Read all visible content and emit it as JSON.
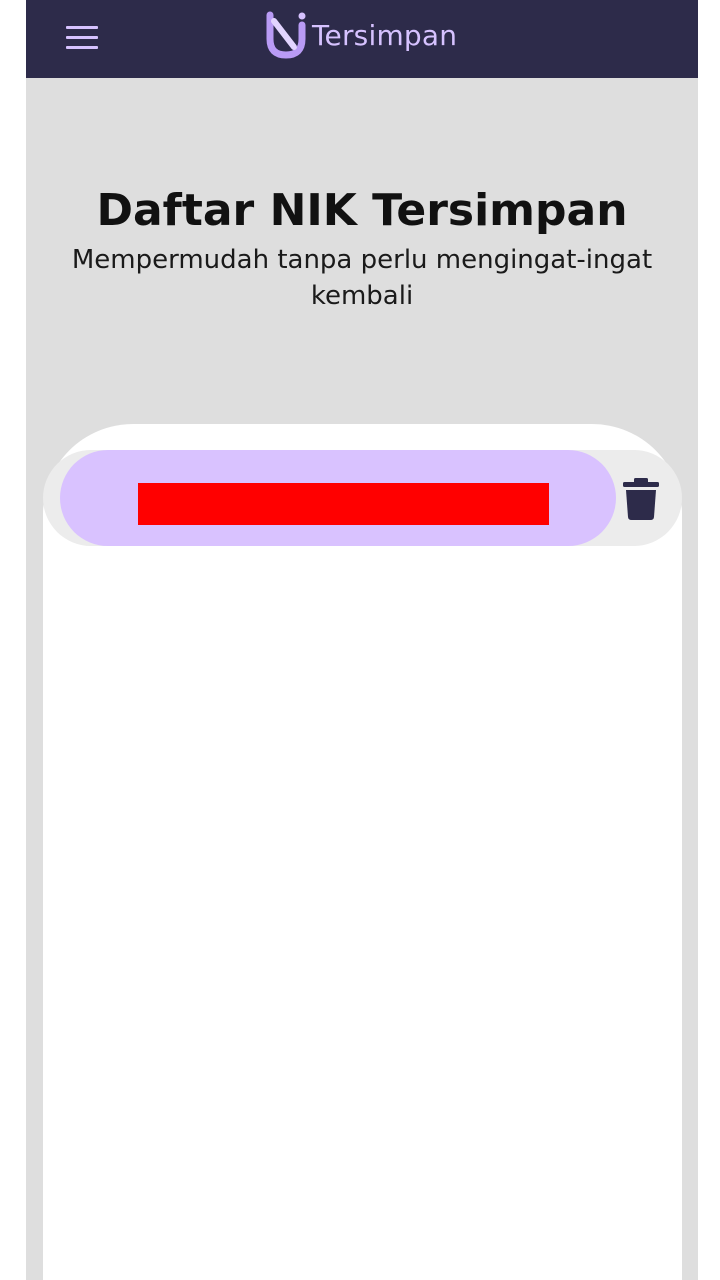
{
  "header": {
    "menu_icon": "hamburger-menu-icon",
    "logo_icon": "brand-logo-icon",
    "title": "Tersimpan"
  },
  "hero": {
    "title": "Daftar NIK Tersimpan",
    "subtitle": "Mempermudah tanpa perlu mengingat-ingat kembali"
  },
  "saved_list": {
    "items": [
      {
        "nik": "",
        "redacted": true,
        "delete_icon": "trash-icon"
      }
    ]
  },
  "colors": {
    "appbar_bg": "#2d2b4a",
    "accent": "#d6c2ff",
    "page_bg": "#dedede",
    "card_bg": "#ffffff",
    "row_bg": "#ececec",
    "pill_bg": "#d9c2ff",
    "redaction": "#ff0000",
    "trash": "#2d2b4a"
  }
}
